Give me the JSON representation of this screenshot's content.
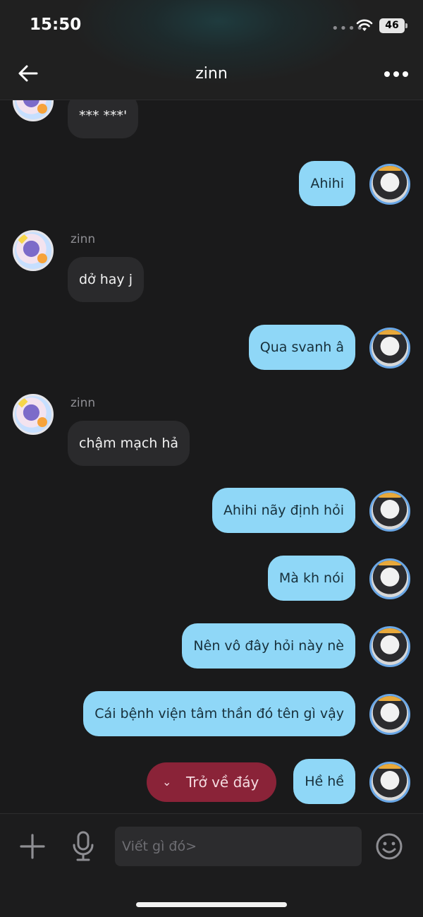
{
  "status_bar": {
    "time": "15:50",
    "signal": "••••",
    "battery": "46"
  },
  "header": {
    "title": "zinn"
  },
  "messages": [
    {
      "text": "*** ***'",
      "from": "them"
    },
    {
      "text": "Ahihi",
      "from": "me"
    },
    {
      "sender": "zinn",
      "text": "dở hay j",
      "from": "them"
    },
    {
      "text": "Qua svanh â",
      "from": "me"
    },
    {
      "sender": "zinn",
      "text": "chậm mạch hả",
      "from": "them"
    },
    {
      "text": "Ahihi nãy định hỏi",
      "from": "me"
    },
    {
      "text": "Mà kh nói",
      "from": "me"
    },
    {
      "text": "Nên vô đây hỏi này nè",
      "from": "me"
    },
    {
      "text": "Cái bệnh viện tâm thần đó tên gì vậy",
      "from": "me"
    },
    {
      "text": "Hề hề",
      "from": "me"
    }
  ],
  "jump_button": {
    "label": "Trở về đáy",
    "icon": "chevron-down-icon"
  },
  "composer": {
    "placeholder": "Viết gì đó>"
  },
  "colors": {
    "outgoing_bubble": "#8fd7f7",
    "incoming_bubble": "#2a2a2c",
    "jump_button": "#8a2338",
    "background": "#1a1a1b"
  }
}
